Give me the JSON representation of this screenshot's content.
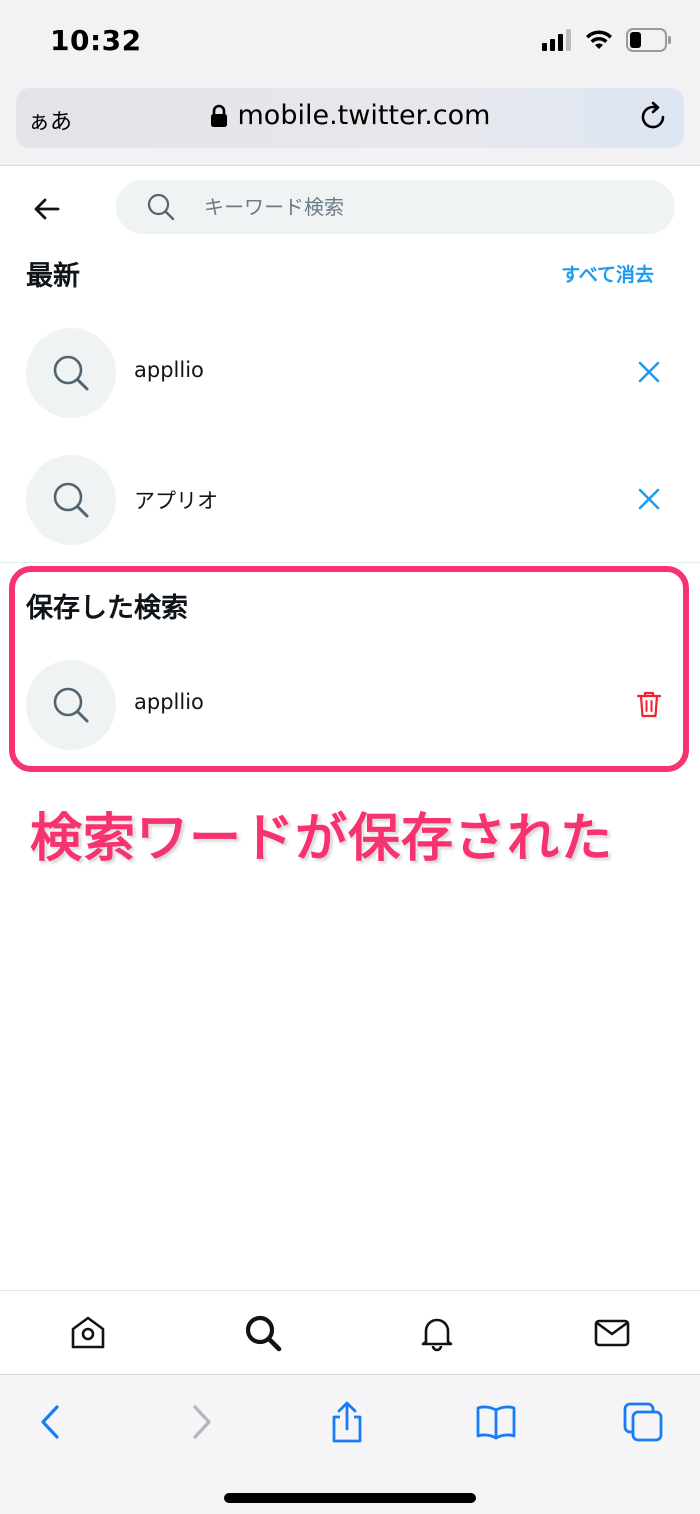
{
  "status_bar": {
    "time": "10:32"
  },
  "browser": {
    "aa_label": "ぁあ",
    "url": "mobile.twitter.com"
  },
  "search": {
    "placeholder": "キーワード検索",
    "value": ""
  },
  "recent": {
    "title": "最新",
    "clear_all_label": "すべて消去",
    "items": [
      {
        "label": "appllio"
      },
      {
        "label": "アプリオ"
      }
    ]
  },
  "saved": {
    "title": "保存した検索",
    "items": [
      {
        "label": "appllio"
      }
    ]
  },
  "annotation": {
    "text": "検索ワードが保存された"
  },
  "colors": {
    "accent": "#1d9bf0",
    "delete": "#f4212e",
    "highlight": "#f7336f",
    "safari_blue": "#1a7cf5"
  },
  "icons": {
    "back": "arrow-left-icon",
    "search": "search-icon",
    "remove": "close-icon",
    "delete": "trash-icon",
    "nav": [
      "home-icon",
      "search-icon",
      "bell-icon",
      "mail-icon"
    ],
    "toolbar": [
      "chevron-left-icon",
      "chevron-right-icon",
      "share-icon",
      "bookmarks-icon",
      "tabs-icon"
    ]
  }
}
